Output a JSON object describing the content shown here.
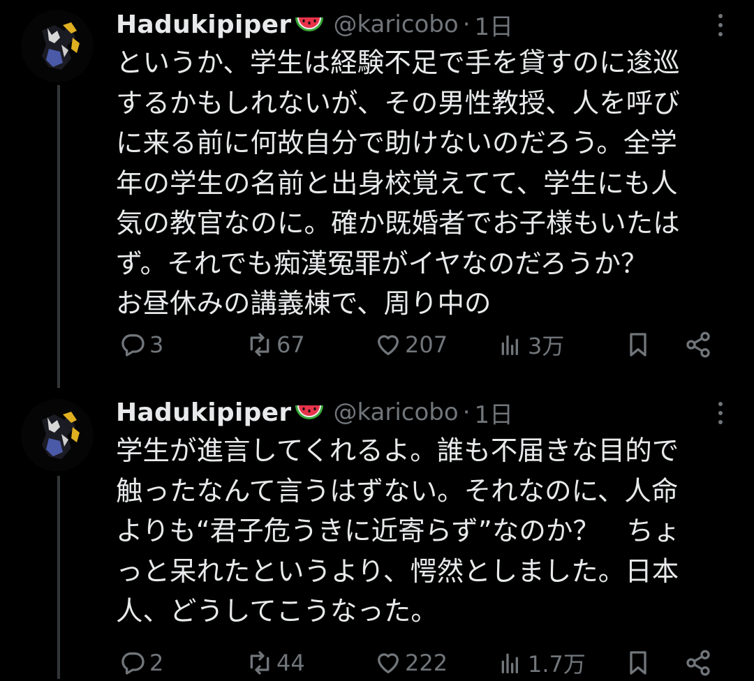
{
  "tweets": [
    {
      "display_name": "Hadukipiper",
      "emoji": "watermelon-emoji",
      "handle": "@karicobo",
      "separator": "·",
      "time": "1日",
      "lines": [
        "というか、学生は経験不足で手を貸すのに逡巡",
        "するかもしれないが、その男性教授、人を呼び",
        "に来る前に何故自分で助けないのだろう。全学",
        "年の学生の名前と出身校覚えてて、学生にも人",
        "気の教官なのに。確か既婚者でお子様もいたは",
        "ず。それでも痴漢冤罪がイヤなのだろうか？",
        "お昼休みの講義棟で、周り中の"
      ],
      "stats": {
        "replies": "3",
        "reposts": "67",
        "likes": "207",
        "views": "3万"
      }
    },
    {
      "display_name": "Hadukipiper",
      "emoji": "watermelon-emoji",
      "handle": "@karicobo",
      "separator": "·",
      "time": "1日",
      "lines": [
        "学生が進言してくれるよ。誰も不届きな目的で",
        "触ったなんて言うはずない。それなのに、人命",
        "よりも“君子危うきに近寄らず”なのか？　ちょ",
        "っと呆れたというより、愕然としました。日本",
        "人、どうしてこうなった。"
      ],
      "stats": {
        "replies": "2",
        "reposts": "44",
        "likes": "222",
        "views": "1.7万"
      }
    }
  ],
  "colors": {
    "background": "#000000",
    "text": "#e7e9ea",
    "muted": "#71767b",
    "thread_line": "#333639"
  }
}
